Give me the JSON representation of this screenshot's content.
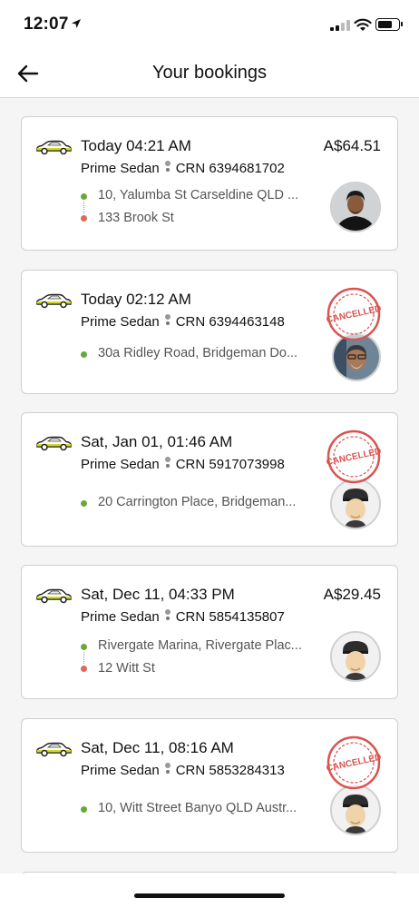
{
  "status_bar": {
    "time": "12:07"
  },
  "header": {
    "title": "Your bookings"
  },
  "bookings": [
    {
      "time": "Today 04:21 AM",
      "price": "A$64.51",
      "ride_type": "Prime Sedan",
      "crn": "CRN 6394681702",
      "pickup": "10, Yalumba St Carseldine QLD ...",
      "drop": "133 Brook St",
      "status": "",
      "driver_avatar": "driver-photo"
    },
    {
      "time": "Today 02:12 AM",
      "price": "",
      "ride_type": "Prime Sedan",
      "crn": "CRN 6394463148",
      "pickup": "30a Ridley Road, Bridgeman Do...",
      "drop": "",
      "status": "CANCELLED",
      "driver_avatar": "driver-photo"
    },
    {
      "time": "Sat, Jan 01, 01:46 AM",
      "price": "",
      "ride_type": "Prime Sedan",
      "crn": "CRN 5917073998",
      "pickup": "20 Carrington Place, Bridgeman...",
      "drop": "",
      "status": "CANCELLED",
      "driver_avatar": "driver-placeholder"
    },
    {
      "time": "Sat, Dec 11, 04:33 PM",
      "price": "A$29.45",
      "ride_type": "Prime Sedan",
      "crn": "CRN 5854135807",
      "pickup": "Rivergate Marina, Rivergate Plac...",
      "drop": "12 Witt St",
      "status": "",
      "driver_avatar": "driver-placeholder"
    },
    {
      "time": "Sat, Dec 11, 08:16 AM",
      "price": "",
      "ride_type": "Prime Sedan",
      "crn": "CRN 5853284313",
      "pickup": "10, Witt Street Banyo QLD Austr...",
      "drop": "",
      "status": "CANCELLED",
      "driver_avatar": "driver-placeholder"
    }
  ],
  "colors": {
    "pickup_dot": "#6aa83b",
    "drop_dot": "#e0675d",
    "cancelled_stamp": "#d9534f"
  }
}
